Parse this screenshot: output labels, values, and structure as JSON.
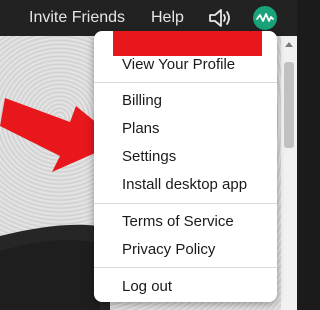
{
  "topbar": {
    "invite_label": "Invite Friends",
    "help_label": "Help",
    "speaker_icon": "speaker-icon",
    "avatar_icon": "waveform-avatar-icon",
    "avatar_color": "#1aa37a"
  },
  "menu": {
    "redaction_color": "#e8171b",
    "groups": [
      [
        "View Your Profile"
      ],
      [
        "Billing",
        "Plans",
        "Settings",
        "Install desktop app"
      ],
      [
        "Terms of Service",
        "Privacy Policy"
      ],
      [
        "Log out"
      ]
    ]
  },
  "annotation": {
    "arrow_color": "#e8171b"
  }
}
